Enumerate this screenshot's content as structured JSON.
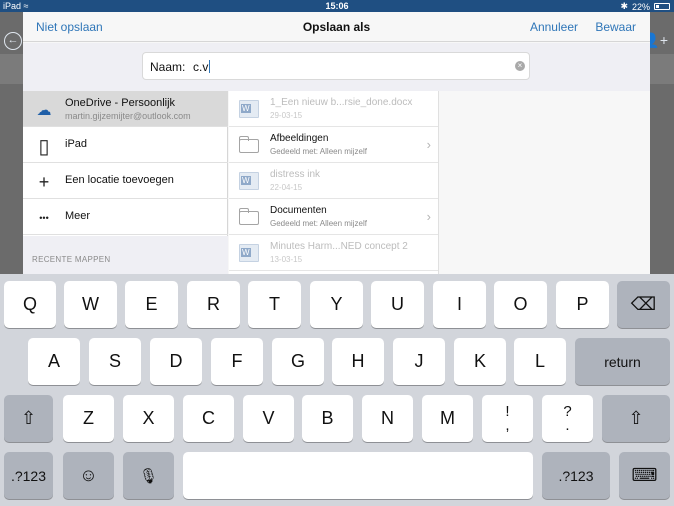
{
  "status_bar": {
    "carrier": "iPad",
    "wifi_glyph": "≈",
    "time": "15:06",
    "bluetooth_glyph": "✱",
    "battery": "22%"
  },
  "colors": {
    "accent": "#2f76b8",
    "status_bar": "#1f4f82",
    "keyboard_bg": "#d2d5db",
    "dark_key": "#aeb3bc"
  },
  "background_app": {
    "back_glyph": "←",
    "add_user_glyph": "👤+"
  },
  "navbar": {
    "cancel_left": "Niet opslaan",
    "title": "Opslaan als",
    "cancel": "Annuleer",
    "save": "Bewaar"
  },
  "name_field": {
    "label": "Naam:",
    "value": "c.v",
    "clear_glyph": "×"
  },
  "locations": [
    {
      "icon": "onedrive-icon",
      "glyph": "☁",
      "label": "OneDrive - Persoonlijk",
      "sub": "martin.gijzemijter@outlook.com",
      "selected": true
    },
    {
      "icon": "ipad-icon",
      "glyph": "▯",
      "label": "iPad"
    },
    {
      "icon": "plus-icon",
      "glyph": "+",
      "label": "Een locatie toevoegen"
    },
    {
      "icon": "more-icon",
      "glyph": "•••",
      "label": "Meer"
    }
  ],
  "recent_header": "RECENTE MAPPEN",
  "files": [
    {
      "type": "doc",
      "name": "1_Een nieuw b...rsie_done.docx",
      "sub": "29-03-15",
      "dim": true
    },
    {
      "type": "folder",
      "name": "Afbeeldingen",
      "sub": "Gedeeld met: Alleen mijzelf",
      "dim": false
    },
    {
      "type": "doc",
      "name": "distress ink",
      "sub": "22-04-15",
      "dim": true
    },
    {
      "type": "folder",
      "name": "Documenten",
      "sub": "Gedeeld met: Alleen mijzelf",
      "dim": false
    },
    {
      "type": "doc",
      "name": "Minutes Harm...NED concept 2",
      "sub": "13-03-15",
      "dim": true
    }
  ],
  "chevron_glyph": "›",
  "keyboard": {
    "row1": [
      "Q",
      "W",
      "E",
      "R",
      "T",
      "Y",
      "U",
      "I",
      "O",
      "P"
    ],
    "row2": [
      "A",
      "S",
      "D",
      "F",
      "G",
      "H",
      "J",
      "K",
      "L"
    ],
    "row3": [
      "Z",
      "X",
      "C",
      "V",
      "B",
      "N",
      "M"
    ],
    "excl": [
      "!",
      ","
    ],
    "question": [
      "?",
      "."
    ],
    "backspace_glyph": "⌫",
    "return": "return",
    "shift_glyph": "⇧",
    "numbers": ".?123",
    "emoji_glyph": "☺",
    "mic_glyph": "🎙",
    "dismiss_glyph": "⌨"
  }
}
